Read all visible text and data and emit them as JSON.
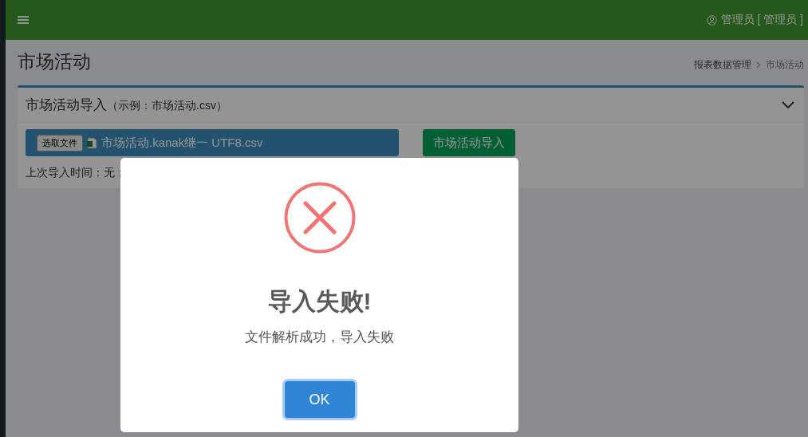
{
  "header": {
    "user": "管理员 [ 管理员 ]"
  },
  "page": {
    "title": "市场活动",
    "breadcrumb": [
      "报表数据管理",
      "市场活动"
    ]
  },
  "panel": {
    "title": "市场活动导入",
    "hint": "（示例：市场活动.csv）",
    "choose_button": "选取文件",
    "file_name": "市场活动.kanak继一 UTF8.csv",
    "import_button": "市场活动导入",
    "last_import": "上次导入时间：无；"
  },
  "dialog": {
    "kind": "error",
    "title": "导入失败!",
    "message": "文件解析成功，导入失败",
    "ok": "OK"
  }
}
